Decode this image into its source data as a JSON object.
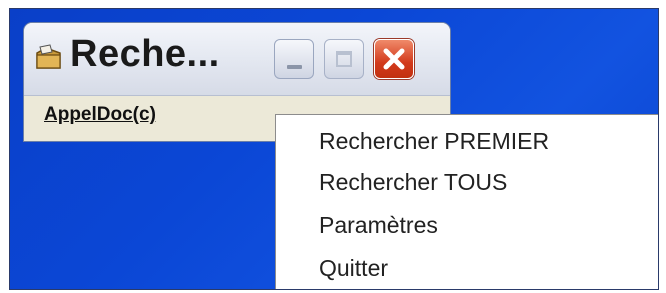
{
  "window": {
    "title": "Reche...",
    "buttons": {
      "minimize": "minimize-icon",
      "maximize": "maximize-icon",
      "close": "close-icon"
    }
  },
  "menubar": {
    "items": [
      {
        "label": "AppelDoc(c)"
      }
    ]
  },
  "popup_menu": {
    "items": [
      {
        "label": "Rechercher PREMIER"
      },
      {
        "label": "Rechercher TOUS"
      },
      {
        "label": "Paramètres"
      },
      {
        "label": "Quitter"
      }
    ]
  },
  "icons": {
    "app": "folder-search-icon"
  },
  "colors": {
    "desktop": "#0b47d6",
    "close_button": "#d23a1c",
    "window_face": "#ece9d8"
  }
}
